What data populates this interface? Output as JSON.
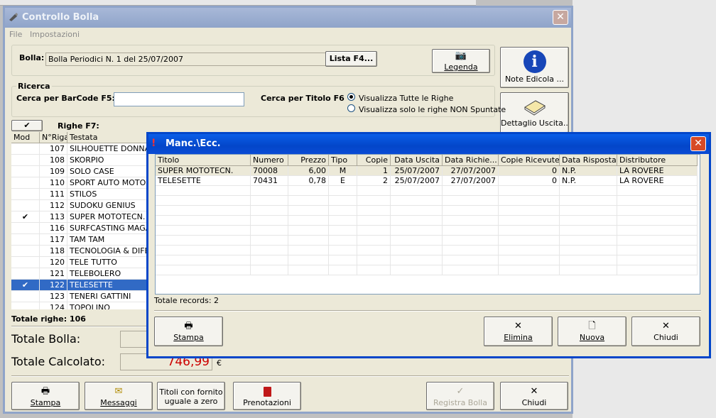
{
  "main": {
    "title": "Controllo Bolla",
    "menu": [
      "File",
      "Impostazioni"
    ],
    "bolla_label": "Bolla:",
    "bolla_value": "Bolla Periodici N. 1 del 25/07/2007",
    "lista_btn": "Lista F4...",
    "legenda_btn": "Legenda",
    "note_btn": "Note Edicola ...",
    "dettaglio_btn": "Dettaglio Uscita...",
    "ricerca_legend": "Ricerca",
    "barcode_label": "Cerca per BarCode F5:",
    "barcode_value": "",
    "titolo_label": "Cerca per Titolo F6",
    "radio1": "Visualizza Tutte le Righe",
    "radio2": "Visualizza solo le righe NON Spuntate",
    "righe_label": "Righe F7:",
    "check_header": "✔",
    "columns": [
      "Mod",
      "N°Riga",
      "Testata"
    ],
    "rows": [
      {
        "mod": "",
        "n": "107",
        "t": "SILHOUETTE DONNA"
      },
      {
        "mod": "",
        "n": "108",
        "t": "SKORPIO"
      },
      {
        "mod": "",
        "n": "109",
        "t": "SOLO CASE"
      },
      {
        "mod": "",
        "n": "110",
        "t": "SPORT AUTO MOTO"
      },
      {
        "mod": "",
        "n": "111",
        "t": "STILOS"
      },
      {
        "mod": "",
        "n": "112",
        "t": "SUDOKU GENIUS"
      },
      {
        "mod": "✔",
        "n": "113",
        "t": "SUPER MOTOTECN."
      },
      {
        "mod": "",
        "n": "116",
        "t": "SURFCASTING MAGAZ"
      },
      {
        "mod": "",
        "n": "117",
        "t": "TAM TAM"
      },
      {
        "mod": "",
        "n": "118",
        "t": "TECNOLOGIA & DIFES"
      },
      {
        "mod": "",
        "n": "120",
        "t": "TELE TUTTO"
      },
      {
        "mod": "",
        "n": "121",
        "t": "TELEBOLERO"
      },
      {
        "mod": "✔",
        "n": "122",
        "t": "TELESETTE"
      },
      {
        "mod": "",
        "n": "123",
        "t": "TENERI GATTINI"
      },
      {
        "mod": "",
        "n": "124",
        "t": "TOPOLINO"
      }
    ],
    "totale_righe": "Totale righe: 106",
    "totale_bolla_label": "Totale Bolla:",
    "totale_calcolato_label": "Totale Calcolato:",
    "totale_calcolato_value": "746,99",
    "euro": "€",
    "bottom_buttons": {
      "stampa": "Stampa",
      "messaggi": "Messaggi",
      "titoli_1": "Titoli con fornito",
      "titoli_2": "uguale a zero",
      "prenotazioni": "Prenotazioni",
      "registra": "Registra Bolla",
      "chiudi": "Chiudi"
    }
  },
  "dialog": {
    "title": "Manc.\\Ecc.",
    "columns": [
      "Titolo",
      "Numero",
      "Prezzo",
      "Tipo",
      "Copie",
      "Data Uscita",
      "Data Richie...",
      "Copie Ricevute",
      "Data Risposta",
      "Distributore"
    ],
    "rows": [
      [
        "SUPER MOTOTECN.",
        "70008",
        "6,00",
        "M",
        "1",
        "25/07/2007",
        "27/07/2007",
        "0",
        "N.P.",
        "LA ROVERE"
      ],
      [
        "TELESETTE",
        "70431",
        "0,78",
        "E",
        "2",
        "25/07/2007",
        "27/07/2007",
        "0",
        "N.P.",
        "LA ROVERE"
      ]
    ],
    "totale_records": "Totale records: 2",
    "stampa": "Stampa",
    "elimina": "Elimina",
    "nuova": "Nuova",
    "chiudi": "Chiudi"
  },
  "colors": {
    "selection": "#316ac5",
    "title_active": "#0346c9",
    "total_red": "#cc0000"
  }
}
